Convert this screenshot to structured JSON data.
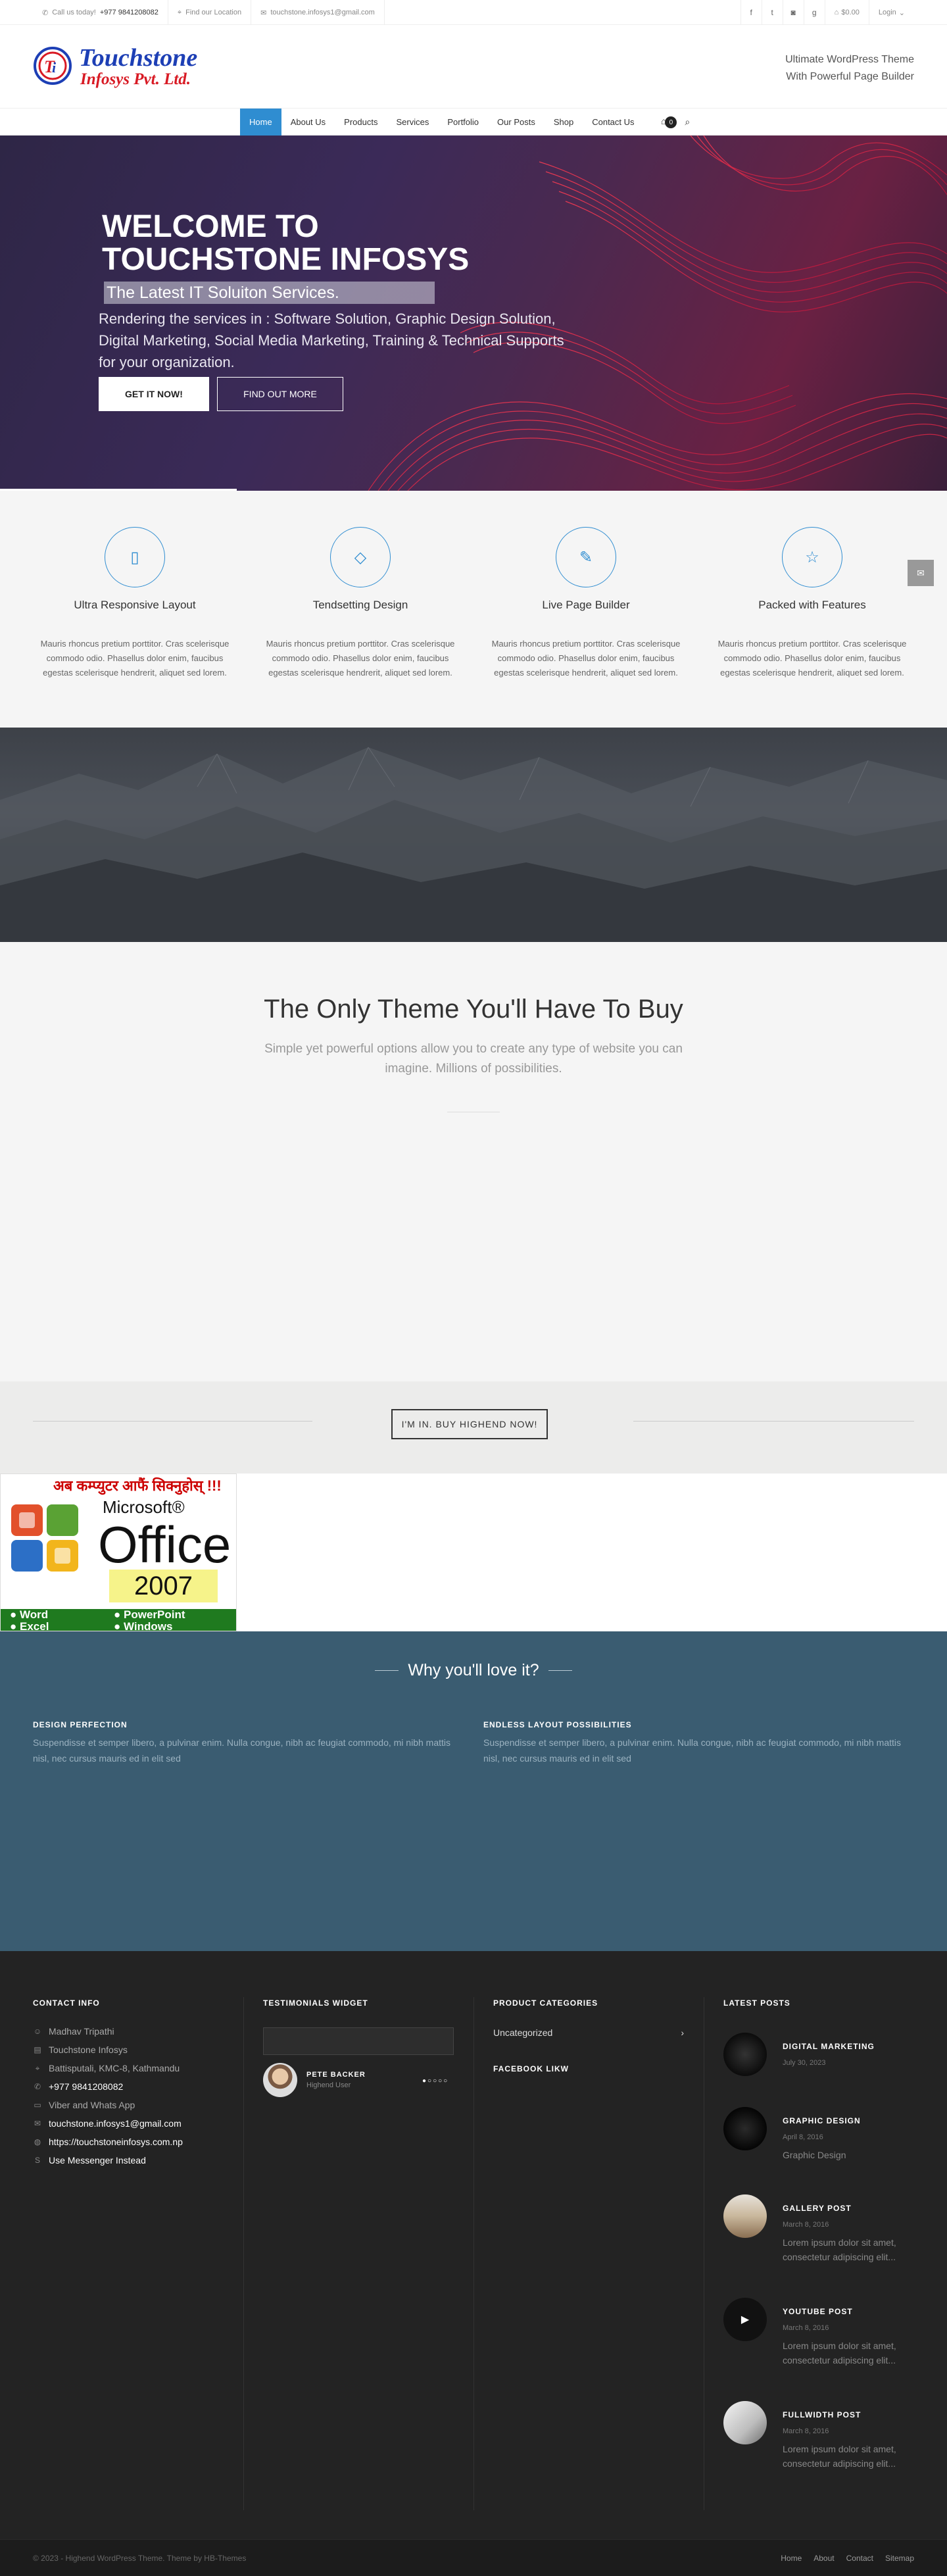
{
  "topbar": {
    "call_label": "Call us today!",
    "phone": "+977 9841208082",
    "location": "Find our Location",
    "email": "touchstone.infosys1@gmail.com",
    "cart": "$0.00",
    "login": "Login"
  },
  "header": {
    "logo_line1": "Touchstone",
    "logo_line2": "Infosys Pvt. Ltd.",
    "tagline1": "Ultimate WordPress Theme",
    "tagline2": "With Powerful Page Builder"
  },
  "nav": {
    "items": [
      "Home",
      "About Us",
      "Products",
      "Services",
      "Portfolio",
      "Our Posts",
      "Shop",
      "Contact Us"
    ],
    "cart_count": "0"
  },
  "hero": {
    "line1": "WELCOME TO",
    "line2": "TOUCHSTONE INFOSYS",
    "subtitle": "The Latest IT Soluiton Services.",
    "description": "Rendering the services in : Software Solution, Graphic Design Solution, Digital Marketing, Social Media Marketing, Training & Technical Supports for your organization.",
    "btn_primary": "GET IT NOW!",
    "btn_secondary": "FIND OUT MORE"
  },
  "features": [
    {
      "title": "Ultra Responsive Layout",
      "text": "Mauris rhoncus pretium porttitor. Cras scelerisque commodo odio. Phasellus dolor enim, faucibus egestas scelerisque hendrerit, aliquet sed lorem.",
      "icon": "tablet-icon"
    },
    {
      "title": "Tendsetting Design",
      "text": "Mauris rhoncus pretium porttitor. Cras scelerisque commodo odio. Phasellus dolor enim, faucibus egestas scelerisque hendrerit, aliquet sed lorem.",
      "icon": "diamond-icon"
    },
    {
      "title": "Live Page Builder",
      "text": "Mauris rhoncus pretium porttitor. Cras scelerisque commodo odio. Phasellus dolor enim, faucibus egestas scelerisque hendrerit, aliquet sed lorem.",
      "icon": "pencil-icon"
    },
    {
      "title": "Packed with Features",
      "text": "Mauris rhoncus pretium porttitor. Cras scelerisque commodo odio. Phasellus dolor enim, faucibus egestas scelerisque hendrerit, aliquet sed lorem.",
      "icon": "star-icon"
    }
  ],
  "only_theme": {
    "title": "The Only Theme You'll Have To Buy",
    "subtitle": "Simple yet powerful options allow you to create any type of website you can imagine. Millions of possibilities."
  },
  "cta": {
    "button": "I'M IN. BUY HIGHEND NOW!"
  },
  "ad": {
    "headline": "अब कम्प्युटर आफैं सिक्नुहोस् !!!",
    "microsoft": "Microsoft®",
    "office": "Office",
    "year": "2007",
    "items": [
      "● Word",
      "● PowerPoint",
      "● Excel",
      "● Windows"
    ]
  },
  "why": {
    "title": "Why you'll love it?",
    "col1_title": "DESIGN PERFECTION",
    "col1_text": "Suspendisse et semper libero, a pulvinar enim. Nulla congue, nibh ac feugiat commodo, mi nibh mattis nisl, nec cursus mauris ed in elit sed",
    "col2_title": "ENDLESS LAYOUT POSSIBILITIES",
    "col2_text": "Suspendisse et semper libero, a pulvinar enim. Nulla congue, nibh ac feugiat commodo, mi nibh mattis nisl, nec cursus mauris ed in elit sed"
  },
  "footer": {
    "contact_title": "CONTACT INFO",
    "contact": [
      "Madhav Tripathi",
      "Touchstone Infosys",
      "Battisputali, KMC-8, Kathmandu",
      "+977 9841208082",
      "Viber and Whats App",
      "touchstone.infosys1@gmail.com",
      "https://touchstoneinfosys.com.np",
      "Use Messenger Instead"
    ],
    "testimonials_title": "TESTIMONIALS WIDGET",
    "testimonial_name": "PETE BACKER",
    "testimonial_role": "Highend User",
    "testimonial_dots": "●○○○○",
    "categories_title": "PRODUCT CATEGORIES",
    "category": "Uncategorized",
    "facebook_title": "FACEBOOK LIKW",
    "posts_title": "LATEST POSTS",
    "posts": [
      {
        "title": "DIGITAL MARKETING",
        "date": "July 30, 2023",
        "excerpt": ""
      },
      {
        "title": "GRAPHIC DESIGN",
        "date": "April 8, 2016",
        "excerpt": "Graphic Design"
      },
      {
        "title": "GALLERY POST",
        "date": "March 8, 2016",
        "excerpt": "Lorem ipsum dolor sit amet, consectetur adipiscing elit..."
      },
      {
        "title": "YOUTUBE POST",
        "date": "March 8, 2016",
        "excerpt": "Lorem ipsum dolor sit amet, consectetur adipiscing elit..."
      },
      {
        "title": "FULLWIDTH POST",
        "date": "March 8, 2016",
        "excerpt": "Lorem ipsum dolor sit amet, consectetur adipiscing elit..."
      }
    ]
  },
  "bottombar": {
    "copyright": "© 2023 - Highend WordPress Theme. Theme by HB-Themes",
    "links": [
      "Home",
      "About",
      "Contact",
      "Sitemap"
    ]
  }
}
